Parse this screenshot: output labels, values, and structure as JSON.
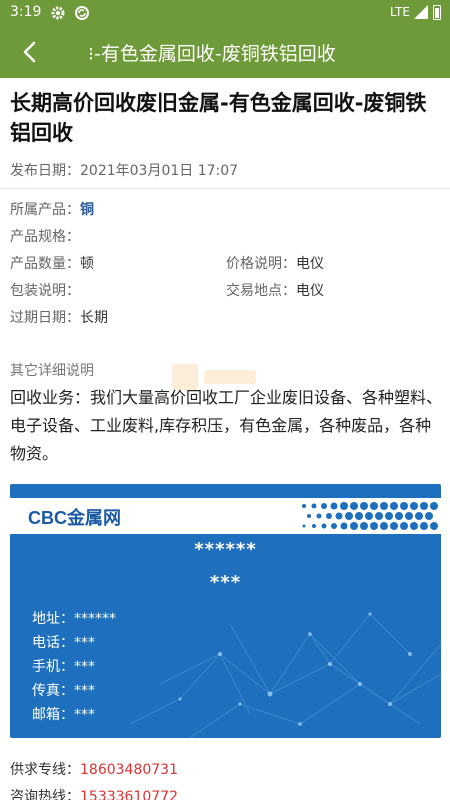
{
  "status_bar": {
    "time": "3:19",
    "network": "LTE"
  },
  "app_bar": {
    "title": "-有色金属回收-废铜铁铝回收",
    "title_prefix": "⁝"
  },
  "article": {
    "title": "长期高价回收废旧金属-有色金属回收-废铜铁铝回收",
    "publish_label": "发布日期：",
    "publish_date": "2021年03月01日 17:07"
  },
  "specs": {
    "category_label": "所属产品：",
    "category_value": "铜",
    "spec_label": "产品规格：",
    "spec_value": "",
    "qty_label": "产品数量：",
    "qty_value": "顿",
    "price_label": "价格说明：",
    "price_value": "电仪",
    "pack_label": "包装说明：",
    "pack_value": "",
    "place_label": "交易地点：",
    "place_value": "电仪",
    "expire_label": "过期日期：",
    "expire_value": "长期"
  },
  "details": {
    "heading": "其它详细说明",
    "body": "回收业务：我们大量高价回收工厂企业废旧设备、各种塑料、电子设备、工业废料,库存积压，有色金属，各种废品，各种物资。"
  },
  "card": {
    "logo": "CBC金属网",
    "name": "******",
    "subtitle": "***",
    "lines": [
      {
        "label": "地址：",
        "value": "******"
      },
      {
        "label": "电话：",
        "value": "***"
      },
      {
        "label": "手机：",
        "value": "***"
      },
      {
        "label": "传真：",
        "value": "***"
      },
      {
        "label": "邮箱：",
        "value": "***"
      }
    ]
  },
  "contacts": {
    "supply_label": "供求专线：",
    "supply_phone": "18603480731",
    "hotline_label": "咨询热线：",
    "hotline_phone": "15333610772"
  },
  "colors": {
    "primary": "#6f9a3a",
    "card": "#1e6fbd",
    "link": "#2d5c98",
    "phone": "#d33333"
  }
}
